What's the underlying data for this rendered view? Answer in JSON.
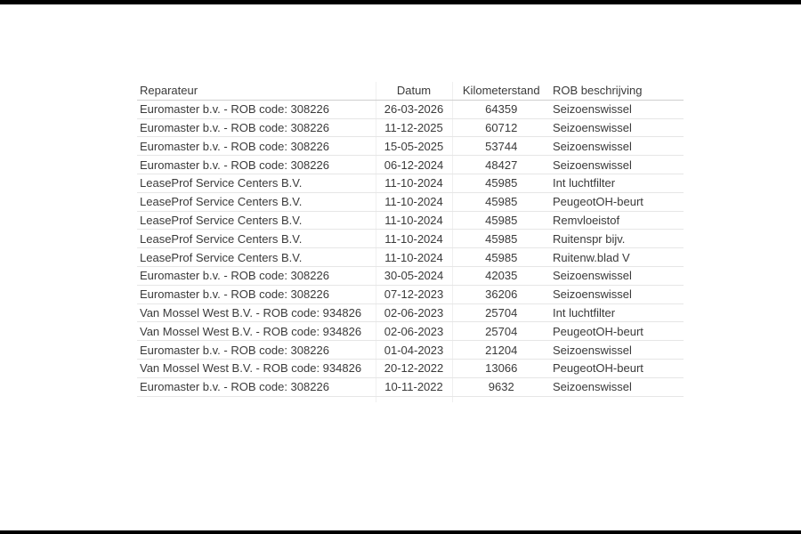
{
  "table": {
    "headers": {
      "reparateur": "Reparateur",
      "datum": "Datum",
      "kilometerstand": "Kilometerstand",
      "rob": "ROB beschrijving"
    },
    "rows": [
      {
        "reparateur": "Euromaster b.v. - ROB code: 308226",
        "datum": "26-03-2026",
        "km": "64359",
        "rob": "Seizoenswissel"
      },
      {
        "reparateur": "Euromaster b.v. - ROB code: 308226",
        "datum": "11-12-2025",
        "km": "60712",
        "rob": "Seizoenswissel"
      },
      {
        "reparateur": "Euromaster b.v. - ROB code: 308226",
        "datum": "15-05-2025",
        "km": "53744",
        "rob": "Seizoenswissel"
      },
      {
        "reparateur": "Euromaster b.v. - ROB code: 308226",
        "datum": "06-12-2024",
        "km": "48427",
        "rob": "Seizoenswissel"
      },
      {
        "reparateur": "LeaseProf Service Centers B.V.",
        "datum": "11-10-2024",
        "km": "45985",
        "rob": "Int luchtfilter"
      },
      {
        "reparateur": "LeaseProf Service Centers B.V.",
        "datum": "11-10-2024",
        "km": "45985",
        "rob": "PeugeotOH-beurt"
      },
      {
        "reparateur": "LeaseProf Service Centers B.V.",
        "datum": "11-10-2024",
        "km": "45985",
        "rob": "Remvloeistof"
      },
      {
        "reparateur": "LeaseProf Service Centers B.V.",
        "datum": "11-10-2024",
        "km": "45985",
        "rob": "Ruitenspr bijv."
      },
      {
        "reparateur": "LeaseProf Service Centers B.V.",
        "datum": "11-10-2024",
        "km": "45985",
        "rob": "Ruitenw.blad V"
      },
      {
        "reparateur": "Euromaster b.v. - ROB code: 308226",
        "datum": "30-05-2024",
        "km": "42035",
        "rob": "Seizoenswissel"
      },
      {
        "reparateur": "Euromaster b.v. - ROB code: 308226",
        "datum": "07-12-2023",
        "km": "36206",
        "rob": "Seizoenswissel"
      },
      {
        "reparateur": "Van Mossel West B.V. - ROB code: 934826",
        "datum": "02-06-2023",
        "km": "25704",
        "rob": "Int luchtfilter"
      },
      {
        "reparateur": "Van Mossel West B.V. - ROB code: 934826",
        "datum": "02-06-2023",
        "km": "25704",
        "rob": "PeugeotOH-beurt"
      },
      {
        "reparateur": "Euromaster b.v. - ROB code: 308226",
        "datum": "01-04-2023",
        "km": "21204",
        "rob": "Seizoenswissel"
      },
      {
        "reparateur": "Van Mossel West B.V. - ROB code: 934826",
        "datum": "20-12-2022",
        "km": "13066",
        "rob": "PeugeotOH-beurt"
      },
      {
        "reparateur": "Euromaster b.v. - ROB code: 308226",
        "datum": "10-11-2022",
        "km": "9632",
        "rob": "Seizoenswissel"
      }
    ]
  }
}
